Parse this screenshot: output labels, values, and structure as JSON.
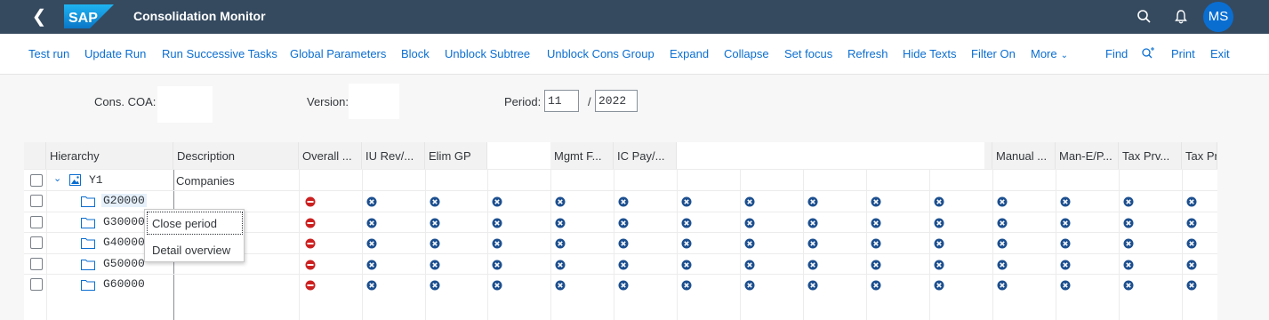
{
  "shell": {
    "title": "Consolidation Monitor",
    "logo_text": "SAP",
    "avatar_initials": "MS"
  },
  "toolbar": {
    "items": [
      "Test run",
      "Update Run",
      "Run Successive Tasks",
      "Global Parameters",
      "Block",
      "Unblock Subtree",
      "Unblock Cons Group",
      "Expand",
      "Collapse",
      "Set focus",
      "Refresh",
      "Hide Texts",
      "Filter On",
      "More"
    ],
    "right": [
      "Find",
      "Print",
      "Exit"
    ]
  },
  "selection": {
    "cons_coa_label": "Cons. COA:",
    "version_label": "Version:",
    "period_label": "Period:",
    "period_value": "11",
    "separator": "/",
    "year_value": "2022"
  },
  "grid": {
    "columns": [
      "Hierarchy",
      "Description",
      "Overall ...",
      "IU Rev/...",
      "Elim GP",
      "Mgmt F...",
      "IC Pay/...",
      "Manual ...",
      "Man-E/P...",
      "Tax Prv...",
      "Tax Pr"
    ],
    "root_node": "Y1",
    "root_description": "Companies",
    "nodes": [
      "G20000",
      "G30000",
      "G40000",
      "G50000",
      "G60000"
    ]
  },
  "context_menu": {
    "items": [
      "Close period",
      "Detail overview"
    ]
  },
  "colors": {
    "shell": "#354a5f",
    "link": "#0a6ed1",
    "status_blocked": "#cc2020",
    "status_open": "#1c4f8f"
  }
}
